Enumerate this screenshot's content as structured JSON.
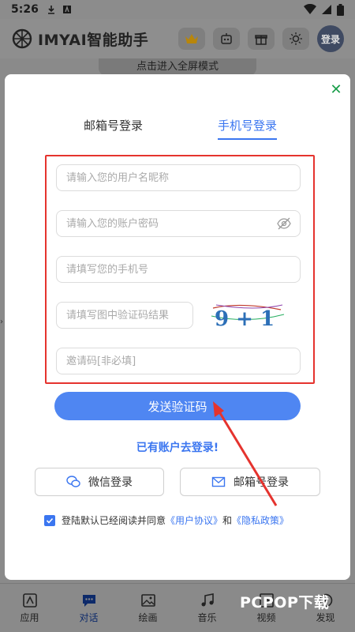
{
  "status_bar": {
    "time": "5:26"
  },
  "header": {
    "app_title": "IMYAI智能助手",
    "login_label": "登录",
    "fullscreen_hint": "点击进入全屏模式"
  },
  "modal": {
    "tabs": {
      "email": "邮箱号登录",
      "phone": "手机号登录",
      "active": "phone"
    },
    "fields": {
      "username_placeholder": "请输入您的用户名昵称",
      "password_placeholder": "请输入您的账户密码",
      "phone_placeholder": "请填写您的手机号",
      "captcha_placeholder": "请填写图中验证码结果",
      "invite_placeholder": "邀请码[非必填]"
    },
    "captcha_text": "9 + 1",
    "send_code_label": "发送验证码",
    "have_account_label": "已有账户去登录!",
    "wechat_login_label": "微信登录",
    "email_login_label": "邮箱号登录",
    "agreement": {
      "prefix": "登陆默认已经阅读并同意",
      "user_agreement": "《用户协议》",
      "and": "和",
      "privacy_policy": "《隐私政策》",
      "checked": true
    }
  },
  "bottom_nav": {
    "items": [
      {
        "label": "应用",
        "icon": "apps-icon"
      },
      {
        "label": "对话",
        "icon": "chat-icon",
        "active": true
      },
      {
        "label": "绘画",
        "icon": "image-icon"
      },
      {
        "label": "音乐",
        "icon": "music-icon"
      },
      {
        "label": "视频",
        "icon": "video-icon"
      },
      {
        "label": "发现",
        "icon": "discover-icon"
      }
    ]
  },
  "watermark": "PCPOP下载",
  "colors": {
    "accent": "#3b76f0",
    "button": "#4f86f2",
    "highlight_border": "#e5332e",
    "close": "#1a9e4a"
  }
}
